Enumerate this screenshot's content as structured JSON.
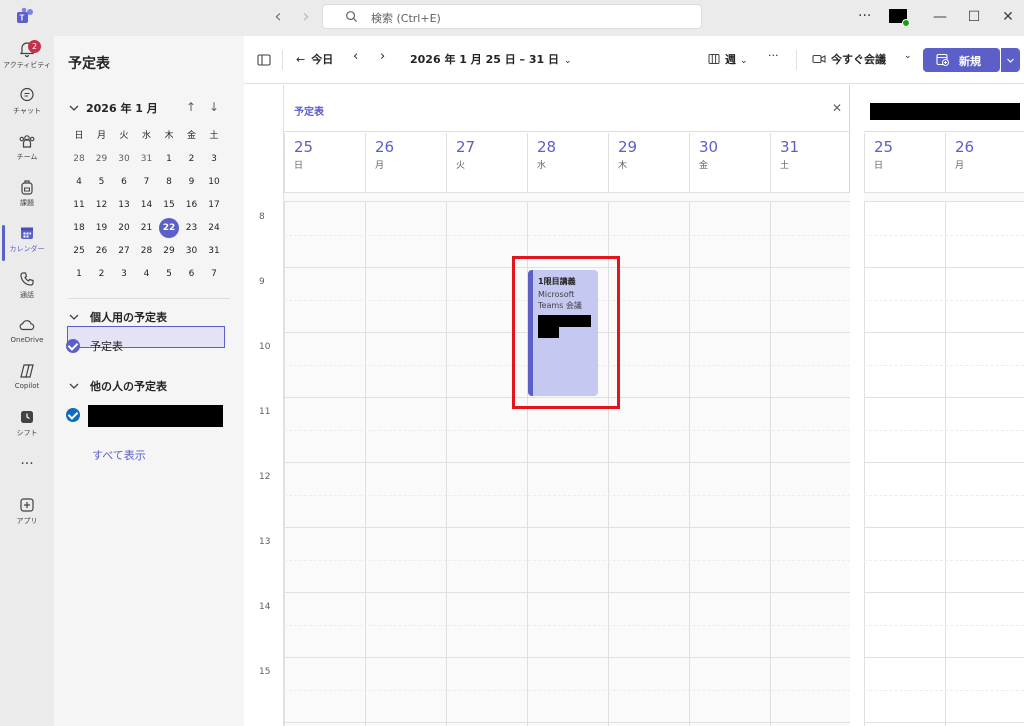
{
  "titlebar": {
    "search_placeholder": "検索 (Ctrl+E)",
    "more": "···",
    "minimize": "—",
    "maximize": "☐",
    "close": "✕"
  },
  "rail": {
    "items": [
      {
        "label": "アクティビティ",
        "icon": "bell-icon",
        "badge": "2"
      },
      {
        "label": "チャット",
        "icon": "chat-icon"
      },
      {
        "label": "チーム",
        "icon": "teams-icon"
      },
      {
        "label": "課題",
        "icon": "backpack-icon"
      },
      {
        "label": "カレンダー",
        "icon": "calendar-icon",
        "active": true
      },
      {
        "label": "通話",
        "icon": "phone-icon"
      },
      {
        "label": "OneDrive",
        "icon": "cloud-icon"
      },
      {
        "label": "Copilot",
        "icon": "copilot-icon"
      },
      {
        "label": "シフト",
        "icon": "clock-icon"
      },
      {
        "label": "···",
        "icon": "more-icon"
      },
      {
        "label": "アプリ",
        "icon": "add-app-icon"
      }
    ]
  },
  "side": {
    "title": "予定表",
    "mini_month": "2026 年 1 月",
    "weekday_headers": [
      "日",
      "月",
      "火",
      "水",
      "木",
      "金",
      "土"
    ],
    "weeks": [
      [
        "28",
        "29",
        "30",
        "31",
        "1",
        "2",
        "3"
      ],
      [
        "4",
        "5",
        "6",
        "7",
        "8",
        "9",
        "10"
      ],
      [
        "11",
        "12",
        "13",
        "14",
        "15",
        "16",
        "17"
      ],
      [
        "18",
        "19",
        "20",
        "21",
        "22",
        "23",
        "24"
      ],
      [
        "25",
        "26",
        "27",
        "28",
        "29",
        "30",
        "31"
      ],
      [
        "1",
        "2",
        "3",
        "4",
        "5",
        "6",
        "7"
      ]
    ],
    "today": "22",
    "personal_section": "個人用の予定表",
    "personal_calendar": "予定表",
    "others_section": "他の人の予定表",
    "show_all": "すべて表示"
  },
  "toolbar": {
    "today": "今日",
    "date_range": "2026 年 1 月 25 日 – 31 日",
    "view": "週",
    "more": "···",
    "meet_now": "今すぐ会議",
    "new": "新規"
  },
  "calendar": {
    "pane_title": "予定表",
    "close": "✕",
    "days": [
      {
        "num": "25",
        "name": "日"
      },
      {
        "num": "26",
        "name": "月"
      },
      {
        "num": "27",
        "name": "火"
      },
      {
        "num": "28",
        "name": "水"
      },
      {
        "num": "29",
        "name": "木"
      },
      {
        "num": "30",
        "name": "金"
      },
      {
        "num": "31",
        "name": "土"
      }
    ],
    "second_pane_days": [
      {
        "num": "25",
        "name": "日"
      },
      {
        "num": "26",
        "name": "月"
      }
    ],
    "hours": [
      "8",
      "9",
      "10",
      "11",
      "12",
      "13",
      "14",
      "15"
    ],
    "event": {
      "title": "1限目講義",
      "subtitle": "Microsoft Teams 会議"
    }
  },
  "colors": {
    "accent": "#5b5fc7",
    "event_bg": "#c5c8f0",
    "highlight": "#e3141b"
  }
}
